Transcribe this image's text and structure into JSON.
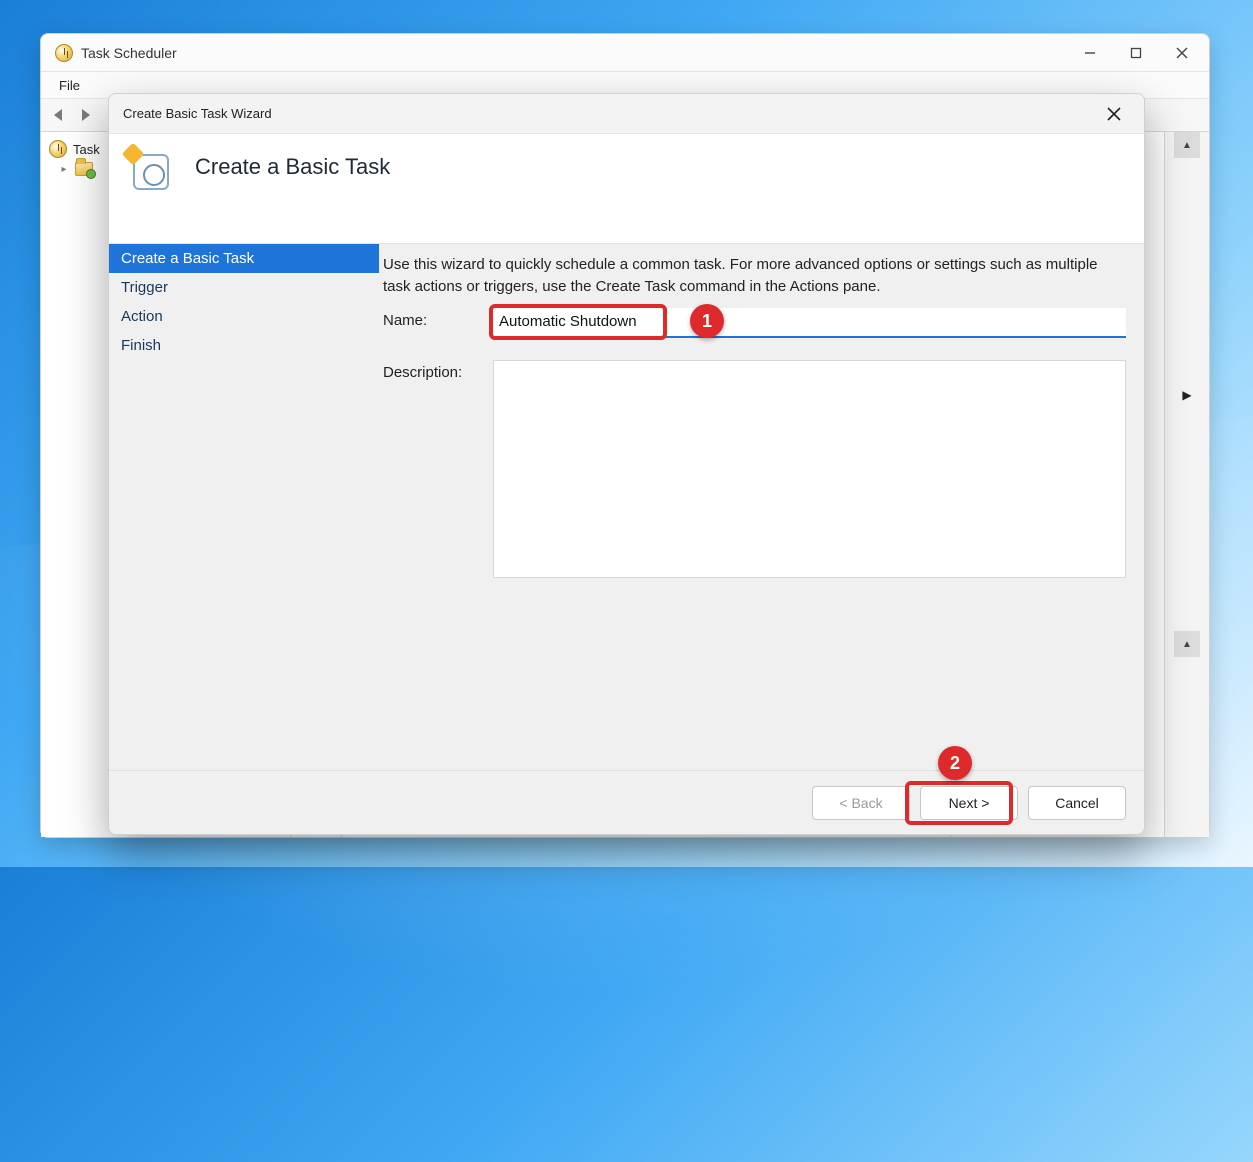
{
  "main_window": {
    "title": "Task Scheduler",
    "menu": {
      "file": "File"
    },
    "tree": {
      "root": "Task Scheduler",
      "root_partial": "Task"
    }
  },
  "wizard": {
    "title": "Create Basic Task Wizard",
    "heading": "Create a Basic Task",
    "nav": [
      "Create a Basic Task",
      "Trigger",
      "Action",
      "Finish"
    ],
    "selected_nav_index": 0,
    "intro": "Use this wizard to quickly schedule a common task.  For more advanced options or settings such as multiple task actions or triggers, use the Create Task command in the Actions pane.",
    "name_label": "Name:",
    "name_value": "Automatic Shutdown",
    "description_label": "Description:",
    "description_value": "",
    "buttons": {
      "back": "< Back",
      "next": "Next >",
      "cancel": "Cancel"
    }
  },
  "annotations": {
    "c1": "1",
    "c2": "2"
  }
}
